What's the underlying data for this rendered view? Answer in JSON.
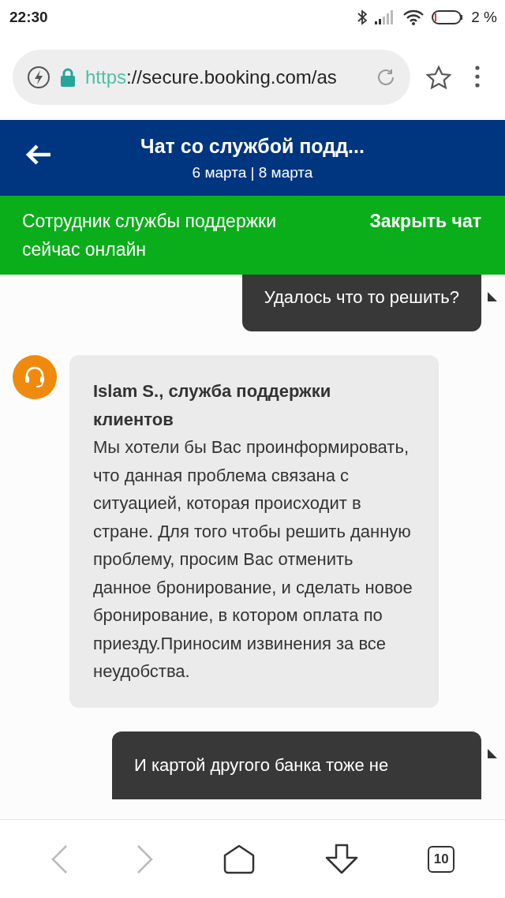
{
  "status_bar": {
    "time": "22:30",
    "battery": "2 %"
  },
  "address_bar": {
    "scheme": "https",
    "rest": "://secure.booking.com/as"
  },
  "header": {
    "title": "Чат со службой подд...",
    "subtitle": "6 марта | 8 марта"
  },
  "banner": {
    "status": "Сотрудник службы поддержки сейчас онлайн",
    "close": "Закрыть чат"
  },
  "messages": [
    {
      "kind": "outgoing",
      "text": "Удалось что то решить?"
    },
    {
      "kind": "incoming",
      "author": "Islam S., служба поддержки клиентов",
      "text": "Мы хотели бы Вас проинформировать, что данная проблема связана с ситуацией, которая происходит в стране. Для того чтобы решить данную проблему, просим Вас отменить данное бронирование, и сделать новое бронирование, в котором оплата по приезду.Приносим извинения за все неудобства."
    },
    {
      "kind": "outgoing",
      "text": "И картой другого банка тоже не"
    }
  ],
  "nav": [
    {
      "kind": "back",
      "disabled": true
    },
    {
      "kind": "forward",
      "disabled": true
    },
    {
      "kind": "home",
      "disabled": false
    },
    {
      "kind": "download",
      "disabled": false
    },
    {
      "kind": "tabs",
      "count": "10",
      "disabled": false
    }
  ]
}
